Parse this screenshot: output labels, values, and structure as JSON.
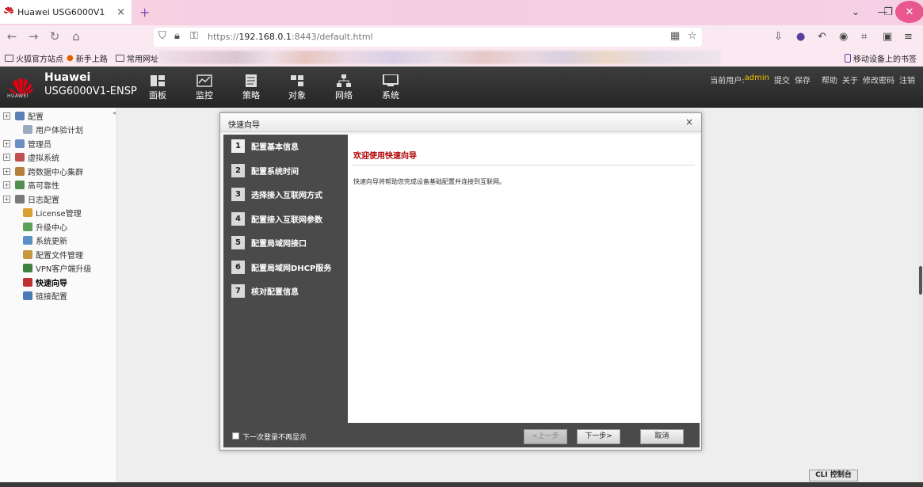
{
  "browser": {
    "tab_title": "Huawei USG6000V1",
    "tab_close": "×",
    "new_tab": "+",
    "url_prefix": "https://",
    "url_host": "192.168.0.1",
    "url_rest": ":8443/default.html",
    "bookmarks": [
      "火狐官方站点",
      "新手上路",
      "常用网址"
    ],
    "bookmark_right": "移动设备上的书签"
  },
  "app": {
    "brand": "Huawei",
    "model": "USG6000V1-ENSP",
    "logo_text": "HUAWEI",
    "menu": [
      {
        "label": "面板",
        "icon": "dashboard-icon"
      },
      {
        "label": "监控",
        "icon": "monitor-icon"
      },
      {
        "label": "策略",
        "icon": "policy-icon"
      },
      {
        "label": "对象",
        "icon": "object-icon"
      },
      {
        "label": "网络",
        "icon": "network-icon"
      },
      {
        "label": "系统",
        "icon": "system-icon"
      }
    ],
    "top_links": {
      "current_user_label": "当前用户:",
      "user": "admin",
      "submit": "提交",
      "save": "保存",
      "help": "帮助",
      "about": "关于",
      "change_password": "修改密码",
      "logout": "注销"
    }
  },
  "sidebar": {
    "items": [
      {
        "label": "配置",
        "expandable": true,
        "color": "#5b7fb7"
      },
      {
        "label": "用户体验计划",
        "expandable": false,
        "color": "#9aa9c0"
      },
      {
        "label": "管理员",
        "expandable": true,
        "color": "#6b8fc3"
      },
      {
        "label": "虚拟系统",
        "expandable": true,
        "color": "#c0504d"
      },
      {
        "label": "跨数据中心集群",
        "expandable": true,
        "color": "#b5803c"
      },
      {
        "label": "高可靠性",
        "expandable": true,
        "color": "#4f8f4f"
      },
      {
        "label": "日志配置",
        "expandable": true,
        "color": "#7a7a7a"
      },
      {
        "label": "License管理",
        "expandable": false,
        "color": "#d8a030"
      },
      {
        "label": "升级中心",
        "expandable": false,
        "color": "#5aa05a"
      },
      {
        "label": "系统更新",
        "expandable": false,
        "color": "#5a90c8"
      },
      {
        "label": "配置文件管理",
        "expandable": false,
        "color": "#c89640"
      },
      {
        "label": "VPN客户端升级",
        "expandable": false,
        "color": "#3f7f3f"
      },
      {
        "label": "快速向导",
        "expandable": false,
        "color": "#c03030",
        "active": true
      },
      {
        "label": "链接配置",
        "expandable": false,
        "color": "#4a7ab8"
      }
    ]
  },
  "dialog": {
    "title": "快速向导",
    "close": "×",
    "steps": [
      {
        "num": "1",
        "label": "配置基本信息"
      },
      {
        "num": "2",
        "label": "配置系统时间"
      },
      {
        "num": "3",
        "label": "选择接入互联网方式"
      },
      {
        "num": "4",
        "label": "配置接入互联网参数"
      },
      {
        "num": "5",
        "label": "配置局域网接口"
      },
      {
        "num": "6",
        "label": "配置局域网DHCP服务"
      },
      {
        "num": "7",
        "label": "核对配置信息"
      }
    ],
    "welcome_title": "欢迎使用快速向导",
    "welcome_desc": "快速向导将帮助您完成设备基础配置并连接到互联网。",
    "dont_show_label": "下一次登录不再显示",
    "prev_button": "<上一步",
    "next_button": "下一步>",
    "cancel_button": "取消"
  },
  "cli_button": "CLI 控制台"
}
